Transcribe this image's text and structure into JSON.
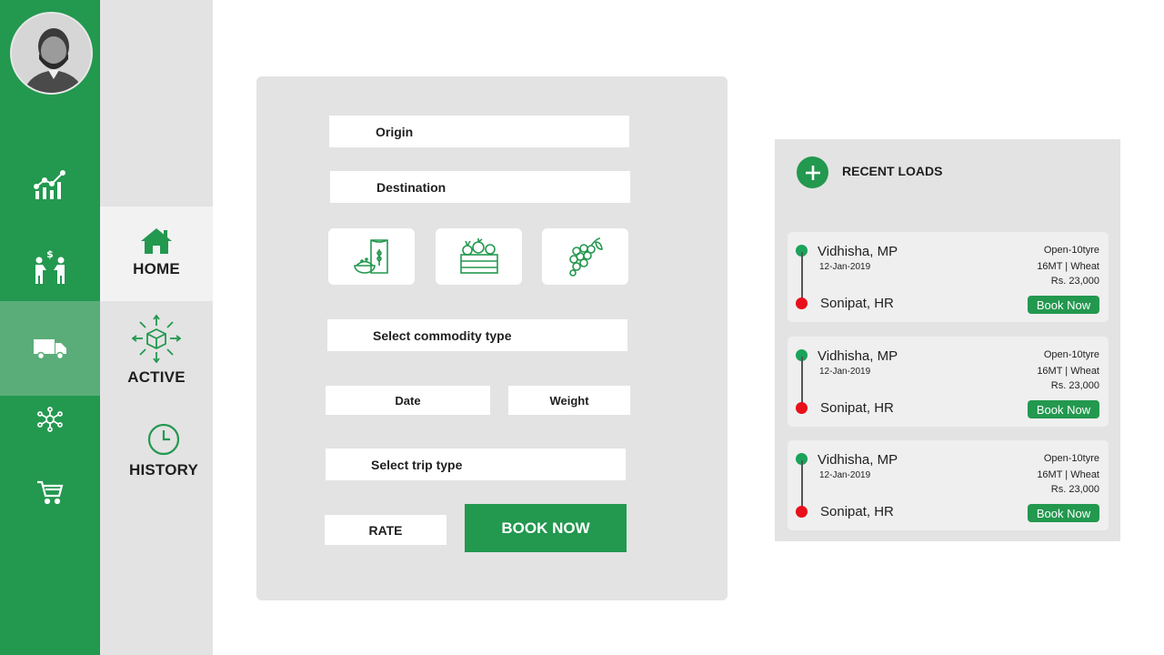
{
  "sidebar": {
    "avatar_alt": "user-avatar",
    "icons": [
      "analytics-icon",
      "payment-exchange-icon",
      "truck-icon",
      "network-icon",
      "cart-icon"
    ]
  },
  "subnav": {
    "home": "HOME",
    "active": "ACTIVE",
    "history": "HISTORY"
  },
  "form": {
    "origin": "Origin",
    "destination": "Destination",
    "commodity_icons": [
      "grain-sack-icon",
      "vegetable-crate-icon",
      "grapes-icon"
    ],
    "commodity": "Select commodity type",
    "date": "Date",
    "weight": "Weight",
    "trip_type": "Select trip type",
    "rate": "RATE",
    "book_now": "BOOK NOW"
  },
  "recent_loads": {
    "title": "RECENT LOADS",
    "items": [
      {
        "origin": "Vidhisha, MP",
        "date": "12-Jan-2019",
        "destination": "Sonipat, HR",
        "truck": "Open-10tyre",
        "load": "16MT | Wheat",
        "price": "Rs. 23,000",
        "button": "Book Now"
      },
      {
        "origin": "Vidhisha, MP",
        "date": "12-Jan-2019",
        "destination": "Sonipat, HR",
        "truck": "Open-10tyre",
        "load": "16MT | Wheat",
        "price": "Rs. 23,000",
        "button": "Book Now"
      },
      {
        "origin": "Vidhisha, MP",
        "date": "12-Jan-2019",
        "destination": "Sonipat, HR",
        "truck": "Open-10tyre",
        "load": "16MT | Wheat",
        "price": "Rs. 23,000",
        "button": "Book Now"
      }
    ]
  },
  "colors": {
    "brand_green": "#23984f",
    "origin_dot": "#1aa35a",
    "destination_dot": "#e8101a"
  }
}
